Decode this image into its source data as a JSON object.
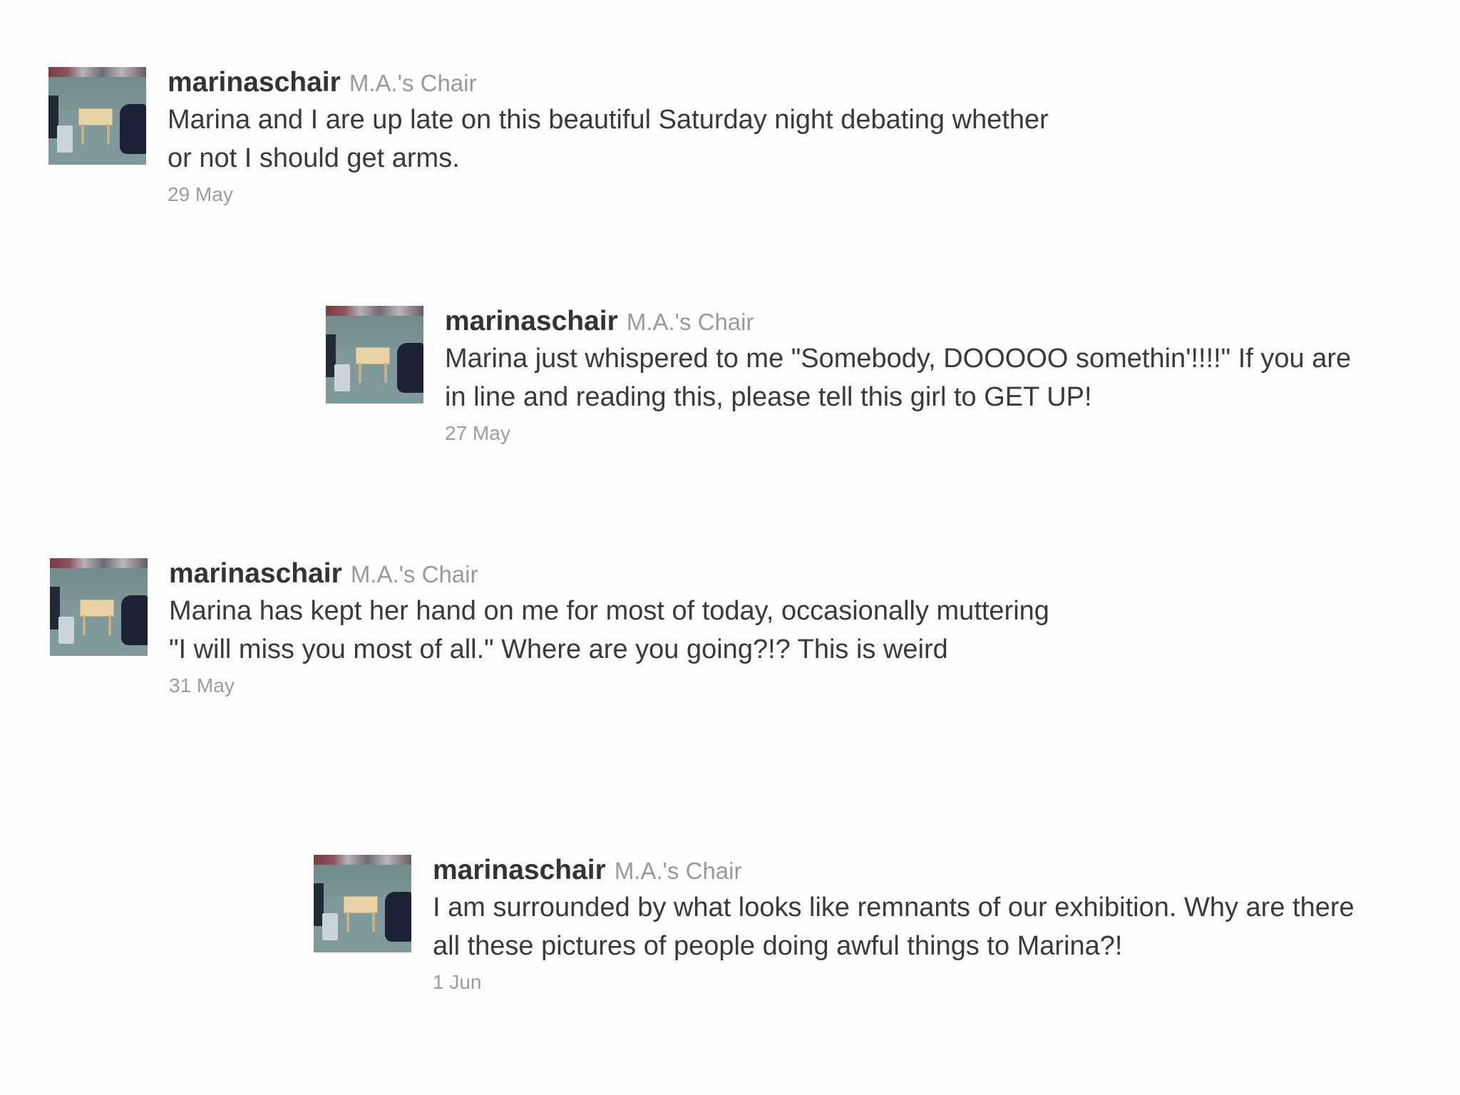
{
  "tweets": [
    {
      "username": "marinaschair",
      "display_name": "M.A.'s Chair",
      "text": "Marina and I are up late on this beautiful Saturday night debating whether or not I should get arms.",
      "date": "29 May"
    },
    {
      "username": "marinaschair",
      "display_name": "M.A.'s Chair",
      "text": "Marina just whispered to me \"Somebody, DOOOOO somethin'!!!!\" If you are in line and reading this, please tell this girl to GET UP!",
      "date": "27 May"
    },
    {
      "username": "marinaschair",
      "display_name": "M.A.'s Chair",
      "text": "Marina has kept her hand on me for most of today, occasionally muttering \"I will miss you most of all.\" Where are you going?!? This is weird",
      "date": "31 May"
    },
    {
      "username": "marinaschair",
      "display_name": "M.A.'s Chair",
      "text": "I am surrounded by what looks like remnants of our exhibition. Why are there all these pictures of people doing awful things to Marina?!",
      "date": "1 Jun"
    }
  ]
}
